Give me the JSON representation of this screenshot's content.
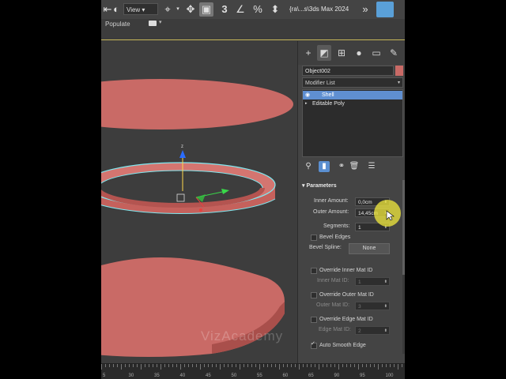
{
  "toolbar": {
    "view_select": "View",
    "path_label": "{ra\\...s\\3ds Max 2024",
    "more": "»"
  },
  "ribbon": {
    "populate_label": "Populate"
  },
  "viewport": {
    "watermark": "VizAcademy"
  },
  "panel": {
    "object_name": "Object002",
    "object_color": "#c96a66",
    "modifier_list": "Modifier List",
    "stack": [
      {
        "label": "Shell",
        "selected": true
      },
      {
        "label": "Editable Poly",
        "selected": false
      }
    ],
    "rollout_title": "Parameters",
    "inner_amount_label": "Inner Amount:",
    "inner_amount_value": "0,0cm",
    "outer_amount_label": "Outer Amount:",
    "outer_amount_value": "14,45cm",
    "segments_label": "Segments:",
    "segments_value": "1",
    "bevel_edges_label": "Bevel Edges",
    "bevel_spline_label": "Bevel Spline:",
    "bevel_spline_button": "None",
    "override_inner_label": "Override Inner Mat ID",
    "inner_mat_id_label": "Inner Mat ID:",
    "inner_mat_id_value": "1",
    "override_outer_label": "Override Outer Mat ID",
    "outer_mat_id_label": "Outer Mat ID:",
    "outer_mat_id_value": "3",
    "override_edge_label": "Override Edge Mat ID",
    "edge_mat_id_label": "Edge Mat ID:",
    "edge_mat_id_value": "2",
    "auto_smooth_label": "Auto Smooth Edge"
  },
  "timeline": {
    "ticks": [
      "5",
      "30",
      "35",
      "40",
      "45",
      "50",
      "55",
      "60",
      "65",
      "90",
      "95",
      "100"
    ]
  },
  "colors": {
    "object": "#c96a66",
    "selection_highlight": "#5f8fd1",
    "wire": "#7fe8f0",
    "cursor_highlight": "#f1ea3c"
  }
}
